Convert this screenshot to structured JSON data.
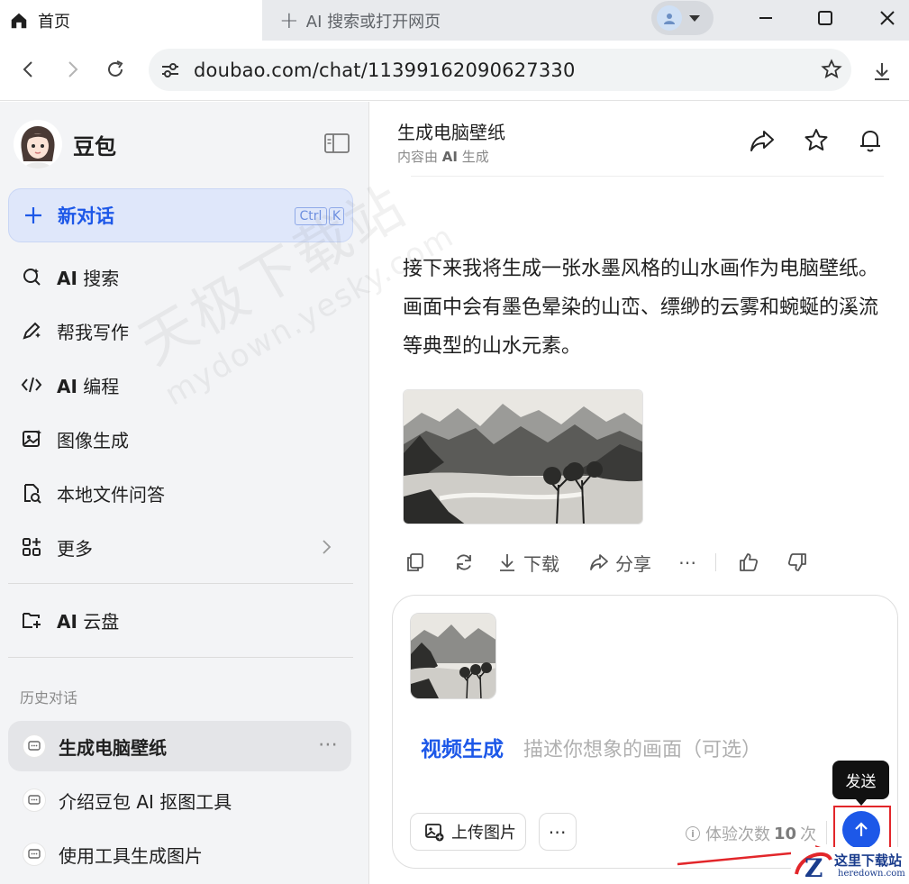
{
  "browser": {
    "active_tab": "首页",
    "new_tab": "AI 搜索或打开网页",
    "url": "doubao.com/chat/11399162090627330"
  },
  "sidebar": {
    "brand": "豆包",
    "new_chat": "新对话",
    "shortcut_ctrl": "Ctrl",
    "shortcut_key": "K",
    "items": [
      {
        "prefix": "AI",
        "label": " 搜索",
        "icon": "ai-search-icon"
      },
      {
        "prefix": "",
        "label": "帮我写作",
        "icon": "pen-icon"
      },
      {
        "prefix": "AI",
        "label": " 编程",
        "icon": "code-icon"
      },
      {
        "prefix": "",
        "label": "图像生成",
        "icon": "image-gen-icon"
      },
      {
        "prefix": "",
        "label": "本地文件问答",
        "icon": "local-file-icon"
      },
      {
        "prefix": "",
        "label": "更多",
        "icon": "grid-icon"
      }
    ],
    "cloud": {
      "prefix": "AI",
      "label": " 云盘"
    },
    "history_label": "历史对话",
    "history": [
      {
        "label": "生成电脑壁纸",
        "active": true
      },
      {
        "label": "介绍豆包 AI 抠图工具",
        "active": false
      },
      {
        "label": "使用工具生成图片",
        "active": false
      }
    ]
  },
  "chat": {
    "title": "生成电脑壁纸",
    "subtitle_pre": "内容由 ",
    "subtitle_ai": "AI",
    "subtitle_post": " 生成",
    "message": "接下来我将生成一张水墨风格的山水画作为电脑壁纸。画面中会有墨色晕染的山峦、缥缈的云雾和蜿蜒的溪流等典型的山水元素。",
    "actions": {
      "download": "下载",
      "share": "分享"
    }
  },
  "composer": {
    "mode": "视频生成",
    "placeholder": "描述你想象的画面（可选）",
    "upload": "上传图片",
    "quota_pre": "体验次数",
    "quota_num": "10",
    "quota_post": "次",
    "send_tooltip": "发送"
  },
  "watermark": {
    "cn": "天极下载站",
    "url": "mydown.yesky.com",
    "corner_title": "这里下载站",
    "corner_url": "heredown.com"
  },
  "colors": {
    "accent": "#1d58e8",
    "annotation": "#e2262a"
  }
}
